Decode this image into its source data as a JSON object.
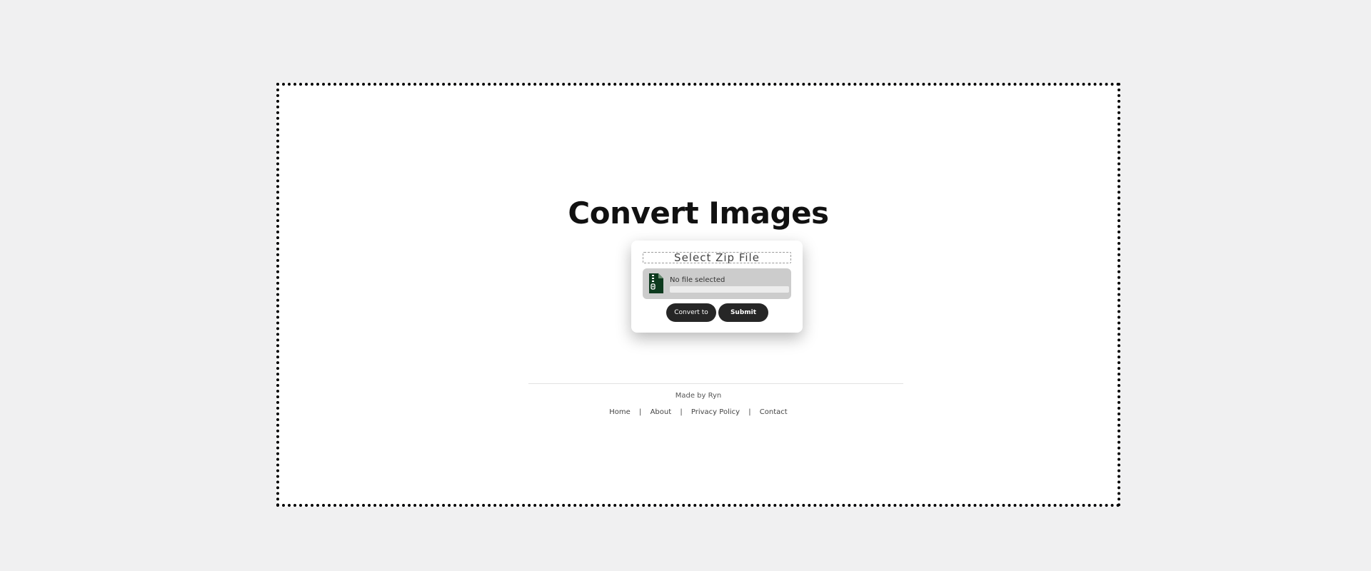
{
  "main": {
    "title": "Convert Images"
  },
  "upload": {
    "select_label": "Select Zip File",
    "file_status": "No file selected",
    "icon": "zip-file-icon",
    "progress": 0,
    "convert_label": "Convert to",
    "submit_label": "Submit"
  },
  "footer": {
    "made_by": "Made by Ryn",
    "links": [
      {
        "label": "Home"
      },
      {
        "label": "About"
      },
      {
        "label": "Privacy Policy"
      },
      {
        "label": "Contact"
      }
    ],
    "separator": "|"
  },
  "colors": {
    "background": "#f0f0f1",
    "panel": "#ffffff",
    "button": "#262626",
    "icon": "#0d3a1e"
  }
}
